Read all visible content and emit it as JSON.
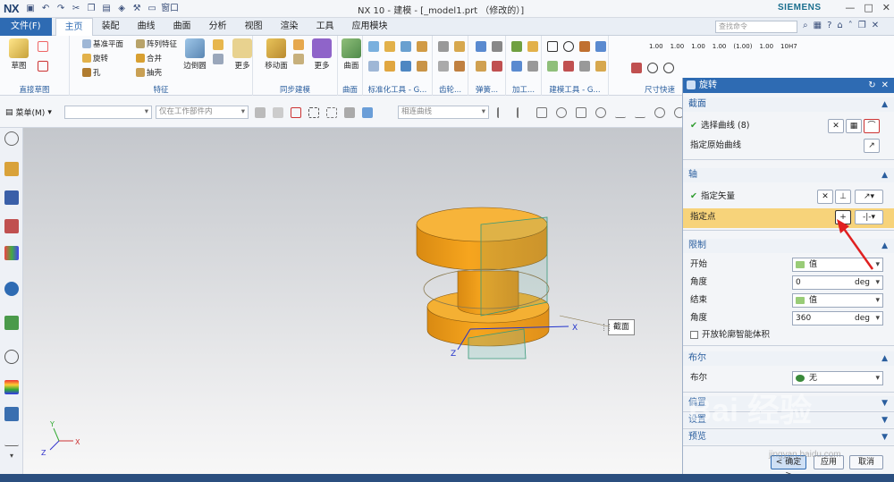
{
  "title_bar": {
    "logo": "NX",
    "window_title": "NX 10 - 建模 - [_model1.prt （修改的）]",
    "brand": "SIEMENS",
    "window_menu": "窗口"
  },
  "menu": {
    "file": "文件(F)",
    "tabs": [
      "主页",
      "装配",
      "曲线",
      "曲面",
      "分析",
      "视图",
      "渲染",
      "工具",
      "应用模块"
    ],
    "active": "主页",
    "search_placeholder": "查找命令"
  },
  "ribbon": {
    "groups": [
      {
        "label": "直接草图",
        "buttons": [
          "草图"
        ]
      },
      {
        "label": "特征",
        "small": [
          "基准平面",
          "阵列特征",
          "旋转",
          "合并",
          "孔",
          "抽壳"
        ],
        "big": [
          "边倒圆",
          "更多"
        ]
      },
      {
        "label": "同步建模",
        "big": [
          "移动面",
          "更多"
        ]
      },
      {
        "label": "曲面",
        "big": [
          "曲面"
        ]
      },
      {
        "label": "标准化工具 - G...",
        "big": []
      },
      {
        "label": "齿轮...",
        "big": []
      },
      {
        "label": "弹簧...",
        "big": []
      },
      {
        "label": "加工...",
        "big": []
      },
      {
        "label": "建模工具 - G...",
        "big": []
      },
      {
        "label": "尺寸快速",
        "big": []
      }
    ],
    "dim_labels": [
      "1.00",
      "1.00",
      "1.00",
      "1.00",
      "(1.00)",
      "1.00",
      "10H7"
    ]
  },
  "toolbar2": {
    "menu": "菜单(M)",
    "filter_placeholder": "",
    "scope": "仅在工作部件内",
    "curve_rule": "相连曲线"
  },
  "viewport": {
    "callout": "截面",
    "axis_x": "X",
    "axis_z": "Z",
    "triad_x": "X",
    "triad_y": "Y",
    "triad_z": "Z"
  },
  "dialog": {
    "title": "旋转",
    "sections": {
      "section": {
        "title": "截面",
        "select_curve": "选择曲线 (8)",
        "specify_origin_curve": "指定原始曲线"
      },
      "axis": {
        "title": "轴",
        "specify_vector": "指定矢量",
        "specify_point": "指定点"
      },
      "limits": {
        "title": "限制",
        "start_label": "开始",
        "start_value": "值",
        "angle1_label": "角度",
        "angle1_value": "0",
        "unit1": "deg",
        "end_label": "结束",
        "end_value": "值",
        "angle2_label": "角度",
        "angle2_value": "360",
        "unit2": "deg",
        "open_profile": "开放轮廓智能体积"
      },
      "boolean": {
        "title": "布尔",
        "label": "布尔",
        "value": "无"
      },
      "offset": {
        "title": "偏置"
      },
      "settings": {
        "title": "设置"
      },
      "preview": {
        "title": "预览"
      }
    },
    "buttons": {
      "ok": "< 确定 >",
      "apply": "应用",
      "cancel": "取消"
    }
  },
  "watermark": {
    "main": "Bai 经验",
    "url": "jingyan.baidu.com"
  }
}
